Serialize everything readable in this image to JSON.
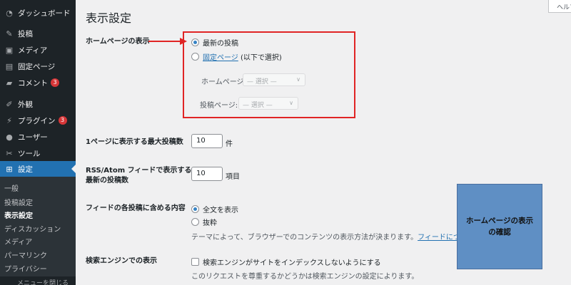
{
  "sidebar": {
    "items": [
      {
        "label": "ダッシュボード",
        "icon": "dashboard-icon"
      },
      {
        "label": "投稿",
        "icon": "pin-icon"
      },
      {
        "label": "メディア",
        "icon": "media-icon"
      },
      {
        "label": "固定ページ",
        "icon": "page-icon"
      },
      {
        "label": "コメント",
        "icon": "comment-icon",
        "badge": "3"
      },
      {
        "label": "外観",
        "icon": "brush-icon"
      },
      {
        "label": "プラグイン",
        "icon": "plugin-icon",
        "badge": "3"
      },
      {
        "label": "ユーザー",
        "icon": "user-icon"
      },
      {
        "label": "ツール",
        "icon": "wrench-icon"
      },
      {
        "label": "設定",
        "icon": "settings-icon",
        "active": true
      }
    ],
    "submenu": [
      "一般",
      "投稿設定",
      "表示設定",
      "ディスカッション",
      "メディア",
      "パーマリンク",
      "プライバシー"
    ],
    "submenu_current": "表示設定",
    "bottom_text": "メニューを閉じる"
  },
  "help_tab": "ヘルプ",
  "page": {
    "title": "表示設定",
    "homepage": {
      "label": "ホームページの表示",
      "option_latest": "最新の投稿",
      "option_static_link": "固定ページ",
      "option_static_rest": " (以下で選択)",
      "homepage_label": "ホームページ:",
      "homepage_select": "— 選択 —",
      "posts_label": "投稿ページ:",
      "posts_select": "— 選択 —"
    },
    "posts_per_page": {
      "label": "1ページに表示する最大投稿数",
      "value": "10",
      "unit": "件"
    },
    "feed_items": {
      "label_line1": "RSS/Atom フィードで表示する",
      "label_line2": "最新の投稿数",
      "value": "10",
      "unit": "項目"
    },
    "feed_content": {
      "label": "フィードの各投稿に含める内容",
      "option_full": "全文を表示",
      "option_excerpt": "抜粋",
      "desc_prefix": "テーマによって、ブラウザーでのコンテンツの表示方法が決まります。",
      "desc_link": "フィードについて"
    },
    "search_engine": {
      "label": "検索エンジンでの表示",
      "checkbox_label": "検索エンジンがサイトをインデックスしないようにする",
      "desc": "このリクエストを尊重するかどうかは検索エンジンの設定によります。"
    }
  },
  "annotation": {
    "callout_text": "ホームページの表示\nの確認",
    "highlight_color": "#e02424",
    "callout_color": "#5f8fc4"
  },
  "colors": {
    "sidebar_bg": "#1d2327",
    "accent": "#2271b1",
    "badge": "#d63638"
  }
}
